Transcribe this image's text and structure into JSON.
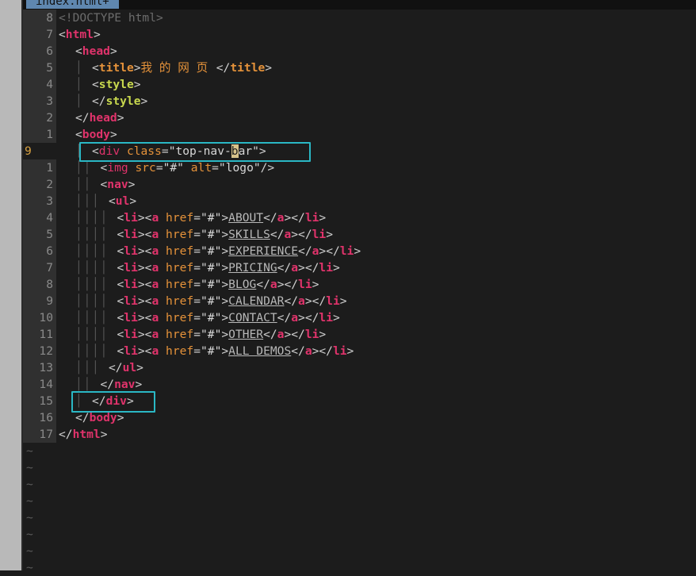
{
  "tab": {
    "label": "index.html+"
  },
  "gutter_current": "9",
  "lines": [
    {
      "n": "8"
    },
    {
      "n": "7"
    },
    {
      "n": "6"
    },
    {
      "n": "5"
    },
    {
      "n": "4"
    },
    {
      "n": "3"
    },
    {
      "n": "2"
    },
    {
      "n": "1"
    },
    {
      "n": "9"
    },
    {
      "n": "1"
    },
    {
      "n": "2"
    },
    {
      "n": "3"
    },
    {
      "n": "4"
    },
    {
      "n": "5"
    },
    {
      "n": "6"
    },
    {
      "n": "7"
    },
    {
      "n": "8"
    },
    {
      "n": "9"
    },
    {
      "n": "10"
    },
    {
      "n": "11"
    },
    {
      "n": "12"
    },
    {
      "n": "13"
    },
    {
      "n": "14"
    },
    {
      "n": "15"
    },
    {
      "n": "16"
    },
    {
      "n": "17"
    }
  ],
  "code": {
    "doctype": "<!DOCTYPE html>",
    "title_text": "我 的 网 页",
    "div_class": "top-nav-bar",
    "img_src": "#",
    "img_alt": "logo",
    "href": "#",
    "links": [
      "ABOUT",
      "SKILLS",
      "EXPERIENCE",
      "PRICING",
      "BLOG",
      "CALENDAR",
      "CONTACT",
      "OTHER",
      "ALL DEMOS"
    ]
  },
  "tilde": "~",
  "colors": {
    "tag": "#e0336b",
    "attr": "#e5923a",
    "string": "#d7d7d7",
    "keyword_green": "#c8d84e",
    "highlight_box": "#2ab7c4",
    "tab_bg": "#5f87af"
  }
}
